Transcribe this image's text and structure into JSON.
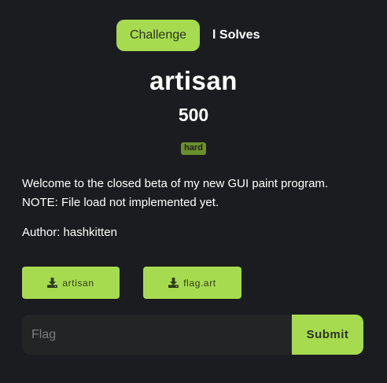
{
  "tabs": {
    "challenge": "Challenge",
    "solves": "l Solves"
  },
  "challenge": {
    "name": "artisan",
    "points": "500",
    "difficulty": "hard",
    "description_line1": "Welcome to the closed beta of my new GUI paint program.",
    "description_line2": "NOTE: File load not implemented yet.",
    "author": "Author: hashkitten"
  },
  "files": [
    {
      "label": "artisan",
      "icon": "download-icon"
    },
    {
      "label": "flag.art",
      "icon": "download-icon"
    }
  ],
  "flag_form": {
    "placeholder": "Flag",
    "value": "",
    "submit_label": "Submit"
  },
  "colors": {
    "background": "#1b1c1f",
    "accent": "#a7db4f",
    "badge": "#6c8f2c",
    "input_bg": "#232426"
  }
}
